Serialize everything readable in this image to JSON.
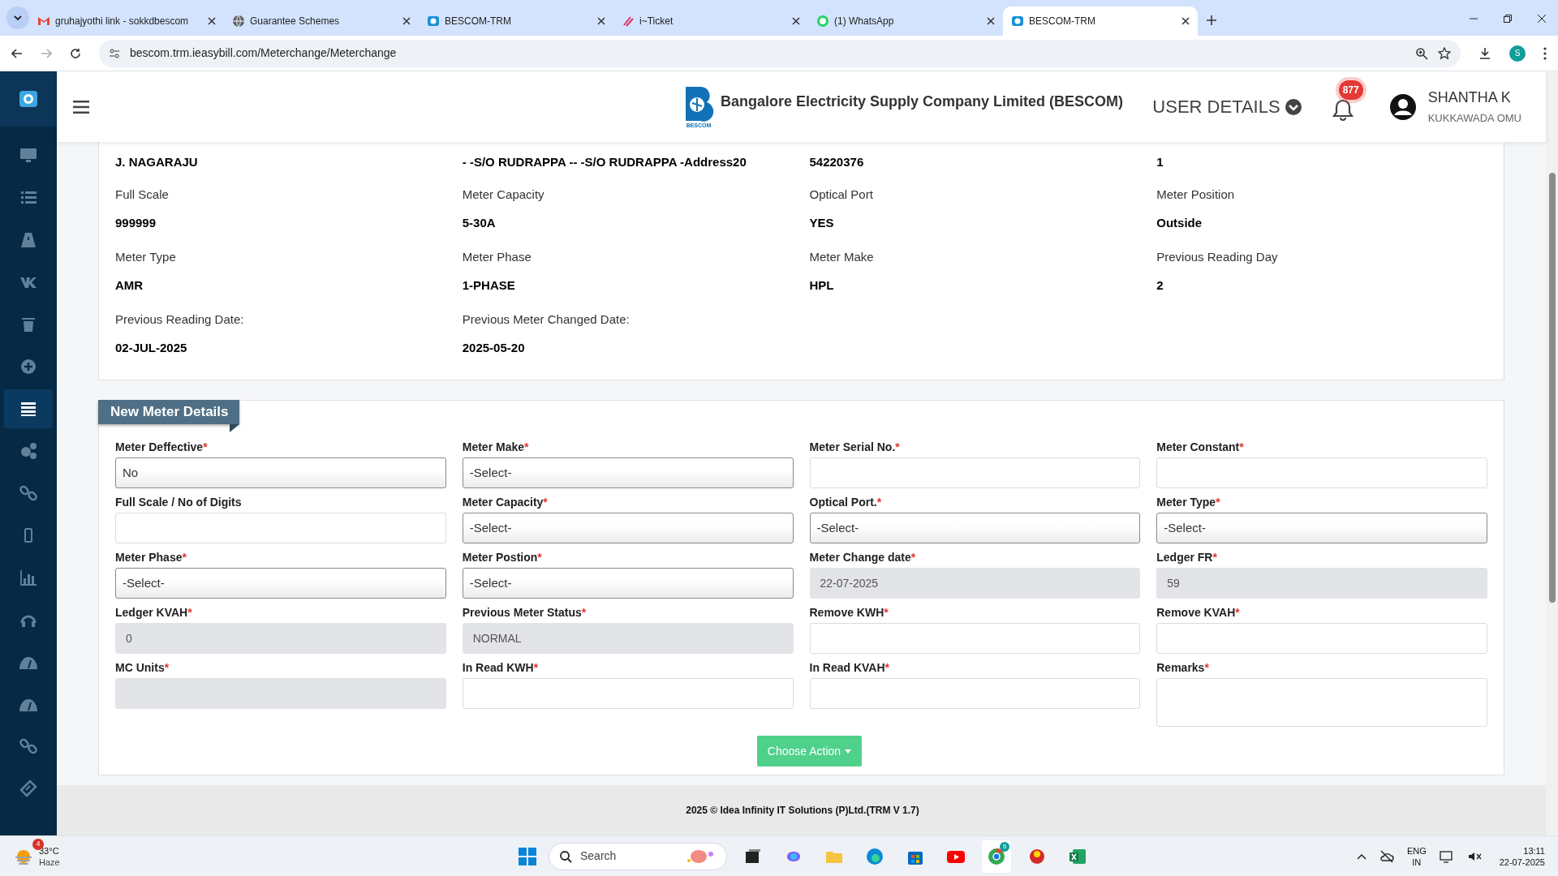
{
  "browser": {
    "tabs": [
      {
        "kind": "mail",
        "title": "gruhajyothi link - sokkdbescom",
        "selected": false
      },
      {
        "kind": "globe",
        "title": "Guarantee Schemes",
        "selected": false
      },
      {
        "kind": "bescom",
        "title": "BESCOM-TRM",
        "selected": false
      },
      {
        "kind": "ticket",
        "title": "i~Ticket",
        "selected": false
      },
      {
        "kind": "whatsapp",
        "title": "(1) WhatsApp",
        "selected": false
      },
      {
        "kind": "bescom",
        "title": "BESCOM-TRM",
        "selected": true
      }
    ],
    "url": "bescom.trm.ieasybill.com/Meterchange/Meterchange",
    "profile": "S"
  },
  "sidebar": {
    "items": [
      {
        "selected": false
      },
      {
        "selected": false
      },
      {
        "selected": false
      },
      {
        "selected": false
      },
      {
        "selected": false
      },
      {
        "selected": false
      },
      {
        "selected": true
      },
      {
        "selected": false
      },
      {
        "selected": false
      },
      {
        "selected": false
      },
      {
        "selected": false
      },
      {
        "selected": false
      },
      {
        "selected": false
      },
      {
        "selected": false
      },
      {
        "selected": false
      },
      {
        "selected": false
      }
    ]
  },
  "header": {
    "logo_text": "BESCOM",
    "title": "Bangalore Electricity Supply Company Limited (BESCOM)",
    "user_details": "USER DETAILS",
    "notifications": "877",
    "user_name": "SHANTHA K",
    "user_office": "KUKKAWADA OMU"
  },
  "current_meter": {
    "top_values": [
      "J. NAGARAJU",
      "- -S/O RUDRAPPA -- -S/O RUDRAPPA -Address20",
      "54220376",
      "1"
    ],
    "fields": [
      {
        "label": "Full Scale",
        "value": "999999"
      },
      {
        "label": "Meter Capacity",
        "value": "5-30A"
      },
      {
        "label": "Optical Port",
        "value": "YES"
      },
      {
        "label": "Meter Position",
        "value": "Outside"
      },
      {
        "label": "Meter Type",
        "value": "AMR"
      },
      {
        "label": "Meter Phase",
        "value": "1-PHASE"
      },
      {
        "label": "Meter Make",
        "value": "HPL"
      },
      {
        "label": "Previous Reading Day",
        "value": "2"
      },
      {
        "label": "Previous Reading Date:",
        "value": "02-JUL-2025"
      },
      {
        "label": "Previous Meter Changed Date:",
        "value": "2025-05-20"
      }
    ]
  },
  "new_meter": {
    "title": "New Meter Details",
    "required_mark": "*",
    "fields": [
      {
        "label": "Meter Deffective",
        "required": true,
        "kind": "select",
        "value": "No"
      },
      {
        "label": "Meter Make",
        "required": true,
        "kind": "select",
        "value": "-Select-"
      },
      {
        "label": "Meter Serial No.",
        "required": true,
        "kind": "text"
      },
      {
        "label": "Meter Constant",
        "required": true,
        "kind": "text"
      },
      {
        "label": "Full Scale / No of Digits",
        "required": false,
        "kind": "text"
      },
      {
        "label": "Meter Capacity",
        "required": true,
        "kind": "select",
        "value": "-Select-"
      },
      {
        "label": "Optical Port.",
        "required": true,
        "kind": "select",
        "value": "-Select-"
      },
      {
        "label": "Meter Type",
        "required": true,
        "kind": "select",
        "value": "-Select-"
      },
      {
        "label": "Meter Phase",
        "required": true,
        "kind": "select",
        "value": "-Select-"
      },
      {
        "label": "Meter Postion",
        "required": true,
        "kind": "select",
        "value": "-Select-"
      },
      {
        "label": "Meter Change date",
        "required": true,
        "kind": "readonly",
        "value": "22-07-2025"
      },
      {
        "label": "Ledger FR",
        "required": true,
        "kind": "readonly",
        "value": "59"
      },
      {
        "label": "Ledger KVAH",
        "required": true,
        "kind": "readonly",
        "value": "0"
      },
      {
        "label": "Previous Meter Status",
        "required": true,
        "kind": "readonly",
        "value": "NORMAL"
      },
      {
        "label": "Remove KWH",
        "required": true,
        "kind": "text"
      },
      {
        "label": "Remove KVAH",
        "required": true,
        "kind": "text"
      },
      {
        "label": "MC Units",
        "required": true,
        "kind": "readonly"
      },
      {
        "label": "In Read KWH",
        "required": true,
        "kind": "text"
      },
      {
        "label": "In Read KVAH",
        "required": true,
        "kind": "text"
      },
      {
        "label": "Remarks",
        "required": true,
        "kind": "textarea"
      }
    ],
    "action": "Choose Action"
  },
  "footer": "2025 © Idea Infinity IT Solutions (P)Ltd.(TRM V 1.7)",
  "taskbar": {
    "weather_badge": "4",
    "temperature": "33°C",
    "condition": "Haze",
    "search": "Search",
    "chrome_badge": "5",
    "language": "ENG",
    "region": "IN",
    "time": "13:11",
    "date": "22-07-2025"
  }
}
